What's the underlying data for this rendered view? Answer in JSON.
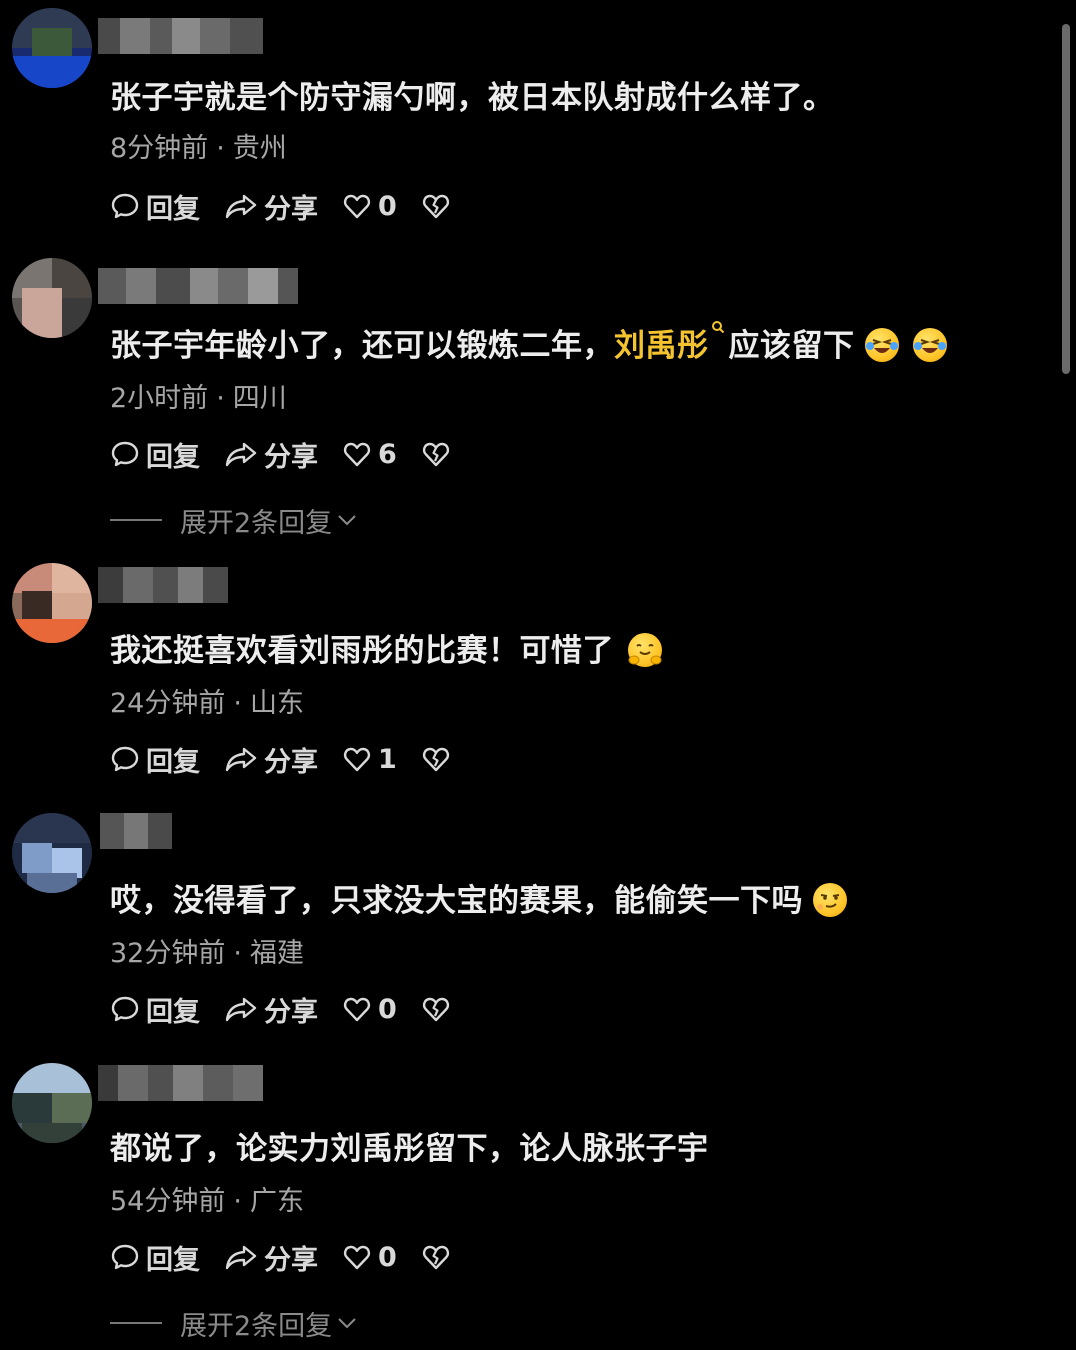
{
  "comments": [
    {
      "text_before": "张子宇就是个防守漏勺啊，被日本队射成什么样了。",
      "highlight": "",
      "text_after": "",
      "time": "8分钟前",
      "dot": "·",
      "location": "贵州",
      "reply_label": "回复",
      "share_label": "分享",
      "likes": "0",
      "expand": ""
    },
    {
      "text_before": "张子宇年龄小了，还可以锻炼二年，",
      "highlight": "刘禹彤",
      "text_after": "应该留下",
      "time": "2小时前",
      "dot": "·",
      "location": "四川",
      "reply_label": "回复",
      "share_label": "分享",
      "likes": "6",
      "expand": "展开2条回复"
    },
    {
      "text_before": "我还挺喜欢看刘雨彤的比赛！可惜了",
      "highlight": "",
      "text_after": "",
      "time": "24分钟前",
      "dot": "·",
      "location": "山东",
      "reply_label": "回复",
      "share_label": "分享",
      "likes": "1",
      "expand": ""
    },
    {
      "text_before": "哎，没得看了，只求没大宝的赛果，能偷笑一下吗",
      "highlight": "",
      "text_after": "",
      "time": "32分钟前",
      "dot": "·",
      "location": "福建",
      "reply_label": "回复",
      "share_label": "分享",
      "likes": "0",
      "expand": ""
    },
    {
      "text_before": "都说了，论实力刘禹彤留下，论人脉张子宇",
      "highlight": "",
      "text_after": "",
      "time": "54分钟前",
      "dot": "·",
      "location": "广东",
      "reply_label": "回复",
      "share_label": "分享",
      "likes": "0",
      "expand": "展开2条回复"
    }
  ],
  "emojis": {
    "c2": [
      "laughing-tears-emoji",
      "laughing-tears-emoji"
    ],
    "c3": [
      "hugging-face-emoji"
    ],
    "c4": [
      "smirk-emoji"
    ]
  },
  "colors": {
    "background": "#000000",
    "text": "#ededed",
    "meta": "#a6a6a6",
    "highlight": "#f4c430"
  }
}
